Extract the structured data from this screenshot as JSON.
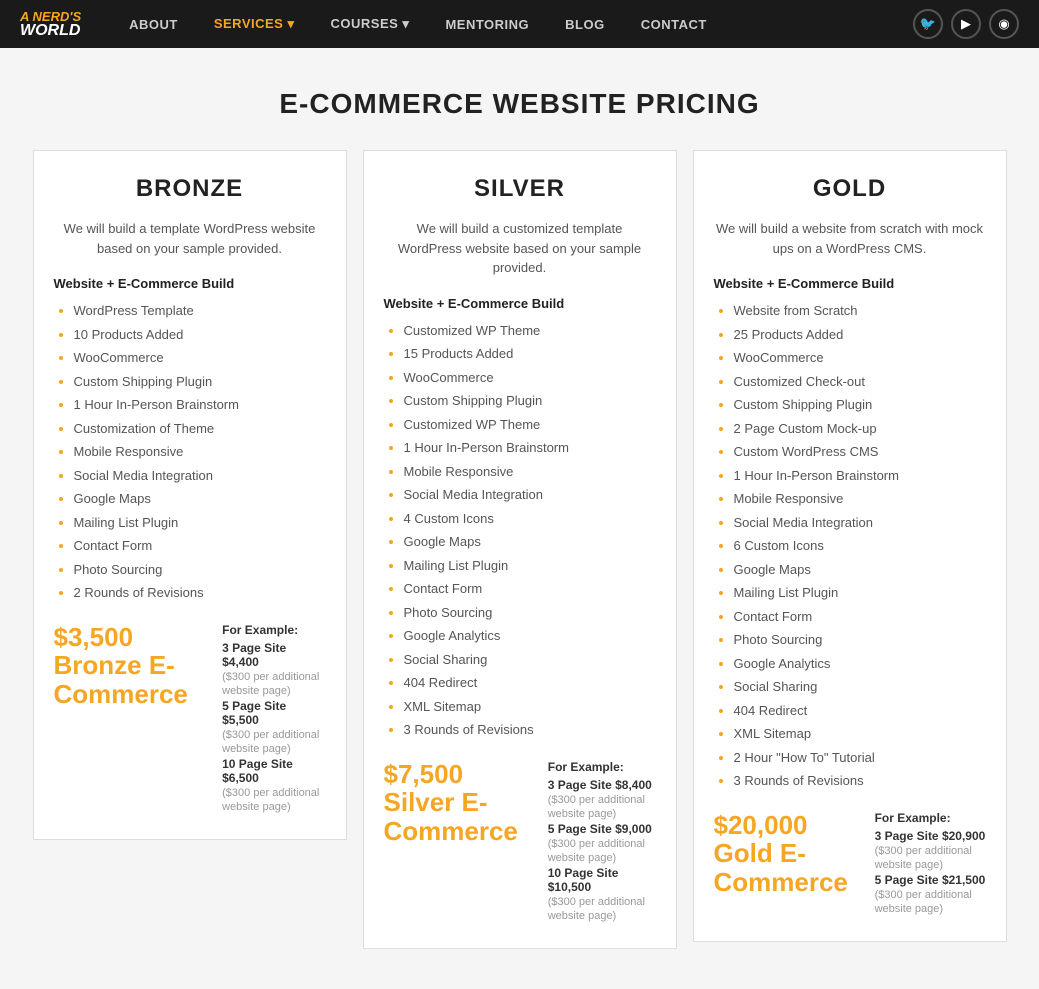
{
  "nav": {
    "logo_line1": "A NERD'S",
    "logo_line2": "WORLD",
    "links": [
      {
        "label": "ABOUT",
        "active": false
      },
      {
        "label": "SERVICES",
        "active": true,
        "has_arrow": true
      },
      {
        "label": "COURSES",
        "active": false,
        "has_arrow": true
      },
      {
        "label": "MENTORING",
        "active": false
      },
      {
        "label": "BLOG",
        "active": false
      },
      {
        "label": "CONTACT",
        "active": false
      }
    ],
    "icons": [
      "🐦",
      "▶",
      "📷"
    ]
  },
  "page_title": "E-COMMERCE WEBSITE PRICING",
  "plans": [
    {
      "id": "bronze",
      "title": "BRONZE",
      "desc": "We will build a template WordPress website based on your sample provided.",
      "section_label": "Website + E-Commerce Build",
      "features": [
        "WordPress Template",
        "10 Products Added",
        "WooCommerce",
        "Custom Shipping Plugin",
        "1 Hour In-Person Brainstorm",
        "Customization of Theme",
        "Mobile Responsive",
        "Social Media Integration",
        "Google Maps",
        "Mailing List Plugin",
        "Contact Form",
        "Photo Sourcing",
        "2 Rounds of Revisions"
      ],
      "big_price": "$3,500",
      "price_label": "Bronze E-Commerce",
      "examples_label": "For Example:",
      "examples": [
        {
          "label": "3 Page Site $4,400",
          "note": "($300 per additional website page)"
        },
        {
          "label": "5 Page Site $5,500",
          "note": "($300 per additional website page)"
        },
        {
          "label": "10 Page Site $6,500",
          "note": "($300 per additional website page)"
        }
      ]
    },
    {
      "id": "silver",
      "title": "SILVER",
      "desc": "We will build a customized template WordPress website based on your sample provided.",
      "section_label": "Website + E-Commerce Build",
      "features": [
        "Customized WP Theme",
        "15 Products Added",
        "WooCommerce",
        "Custom Shipping Plugin",
        "Customized WP Theme",
        "1 Hour In-Person Brainstorm",
        "Mobile Responsive",
        "Social Media Integration",
        "4 Custom Icons",
        "Google Maps",
        "Mailing List Plugin",
        "Contact Form",
        "Photo Sourcing",
        "Google Analytics",
        "Social Sharing",
        "404 Redirect",
        "XML Sitemap",
        "3 Rounds of Revisions"
      ],
      "big_price": "$7,500",
      "price_label": "Silver E-Commerce",
      "examples_label": "For Example:",
      "examples": [
        {
          "label": "3 Page Site $8,400",
          "note": "($300 per additional website page)"
        },
        {
          "label": "5 Page Site $9,000",
          "note": "($300 per additional website page)"
        },
        {
          "label": "10 Page Site $10,500",
          "note": "($300 per additional website page)"
        }
      ]
    },
    {
      "id": "gold",
      "title": "GOLD",
      "desc": "We will build a website from scratch with mock ups on a WordPress CMS.",
      "section_label": "Website + E-Commerce Build",
      "features": [
        "Website from Scratch",
        "25 Products Added",
        "WooCommerce",
        "Customized Check-out",
        "Custom Shipping Plugin",
        "2 Page Custom Mock-up",
        "Custom WordPress CMS",
        "1 Hour In-Person Brainstorm",
        "Mobile Responsive",
        "Social Media Integration",
        "6 Custom Icons",
        "Google Maps",
        "Mailing List Plugin",
        "Contact Form",
        "Photo Sourcing",
        "Google Analytics",
        "Social Sharing",
        "404 Redirect",
        "XML Sitemap",
        "2 Hour \"How To\" Tutorial",
        "3 Rounds of Revisions"
      ],
      "big_price": "$20,000",
      "price_label": "Gold E-Commerce",
      "examples_label": "For Example:",
      "examples": [
        {
          "label": "3 Page Site $20,900",
          "note": "($300 per additional website page)"
        },
        {
          "label": "5 Page Site $21,500",
          "note": "($300 per additional website page)"
        }
      ]
    }
  ]
}
